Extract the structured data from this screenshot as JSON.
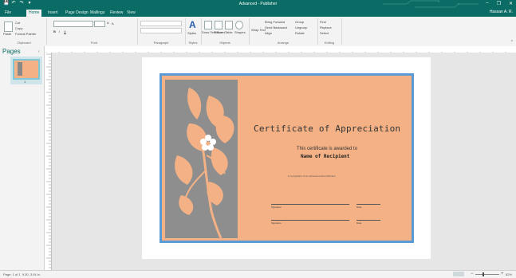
{
  "window": {
    "title": "Advanced - Publisher",
    "user": "Hassan A. R.",
    "controls": {
      "minimize": "–",
      "restore": "❐",
      "close": "✕"
    }
  },
  "qat": {
    "save": "💾",
    "undo": "↶",
    "redo": "↷",
    "more": "▾"
  },
  "ribbon_tabs": [
    "File",
    "Home",
    "Insert",
    "Page Design",
    "Mailings",
    "Review",
    "View"
  ],
  "active_tab": "Home",
  "ribbon": {
    "clipboard": {
      "paste": "Paste",
      "cut": "Cut",
      "copy": "Copy",
      "format_painter": "Format Painter",
      "group": "Clipboard"
    },
    "font": {
      "group": "Font",
      "bold": "B",
      "italic": "I",
      "underline": "U",
      "grow": "A",
      "shrink": "A"
    },
    "paragraph": {
      "group": "Paragraph"
    },
    "styles": {
      "label": "Styles",
      "group": "Styles"
    },
    "objects": {
      "draw_text_box": "Draw Text Box",
      "pictures": "Pictures",
      "table": "Table",
      "shapes": "Shapes",
      "group": "Objects"
    },
    "arrange": {
      "wrap_text": "Wrap Text",
      "bring_forward": "Bring Forward",
      "send_backward": "Send Backward",
      "align": "Align",
      "group_btn": "Group",
      "ungroup": "Ungroup",
      "rotate": "Rotate",
      "group": "Arrange"
    },
    "editing": {
      "find": "Find",
      "replace": "Replace",
      "select": "Select",
      "group": "Editing"
    }
  },
  "pages_pane": {
    "title": "Pages",
    "page_number": "1"
  },
  "certificate": {
    "title": "Certificate of Appreciation",
    "subtitle": "This certificate is awarded to",
    "recipient": "Name of Recipient",
    "recognition": "in recognition of an achievement/contribution",
    "signature_label": "Signature",
    "date_label": "Date",
    "signature_label_2": "Signature",
    "date_label_2": "Date"
  },
  "colors": {
    "accent": "#0a6c64",
    "cert_bg": "#f3b185",
    "cert_border": "#5b9bd5",
    "panel": "#8e8e8e"
  },
  "status": {
    "page_info": "Page: 1 of 1",
    "position": "9.30, 3.04 in.",
    "zoom": "82%"
  }
}
